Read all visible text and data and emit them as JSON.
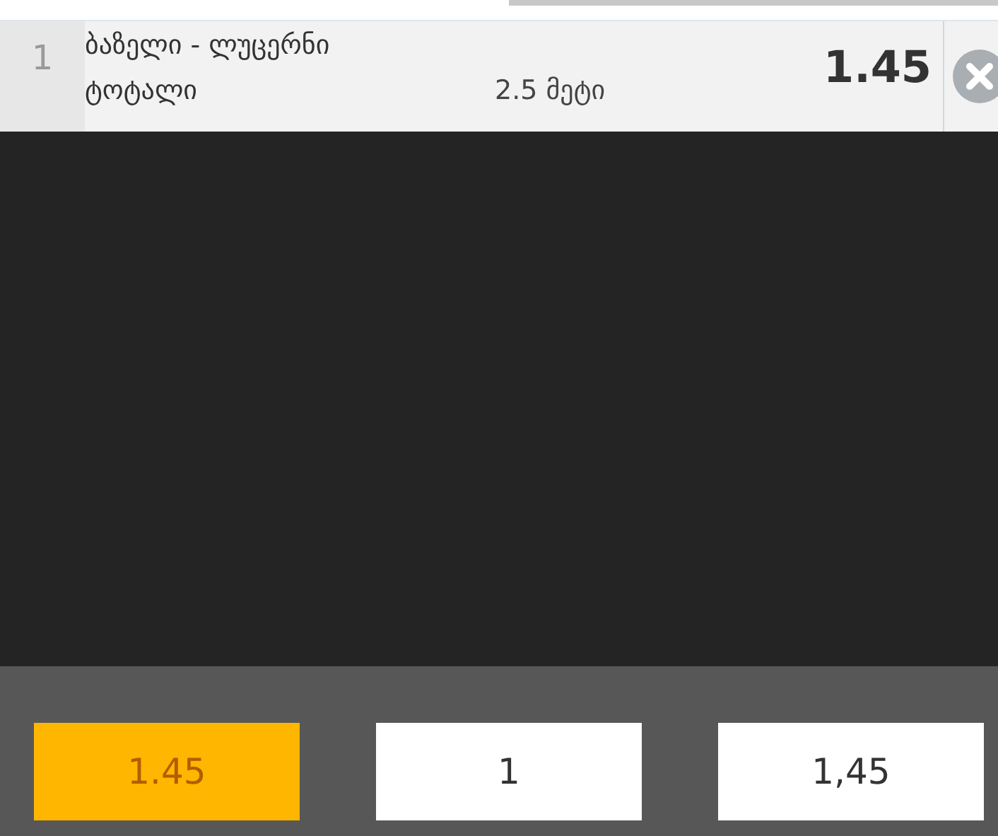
{
  "bets": [
    {
      "index": "1",
      "match": "ბაზელი - ლუცერნი",
      "market": "ტოტალი",
      "selection": "2.5 მეტი",
      "odds": "1.45"
    }
  ],
  "summary": [
    {
      "value": "1.45",
      "selected": true
    },
    {
      "value": "1",
      "selected": false
    },
    {
      "value": "1,45",
      "selected": false
    }
  ]
}
